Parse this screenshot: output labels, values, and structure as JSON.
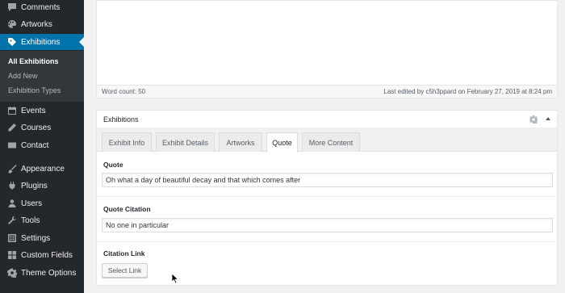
{
  "sidebar": {
    "items": [
      {
        "label": "Comments",
        "icon": "comment-icon"
      },
      {
        "label": "Artworks",
        "icon": "palette-icon"
      },
      {
        "label": "Exhibitions",
        "icon": "tag-icon"
      },
      {
        "label": "Events",
        "icon": "calendar-icon"
      },
      {
        "label": "Courses",
        "icon": "pencil-icon"
      },
      {
        "label": "Contact",
        "icon": "mail-icon"
      },
      {
        "label": "Appearance",
        "icon": "brush-icon"
      },
      {
        "label": "Plugins",
        "icon": "plugin-icon"
      },
      {
        "label": "Users",
        "icon": "users-icon"
      },
      {
        "label": "Tools",
        "icon": "wrench-icon"
      },
      {
        "label": "Settings",
        "icon": "settings-icon"
      },
      {
        "label": "Custom Fields",
        "icon": "grid-icon"
      },
      {
        "label": "Theme Options",
        "icon": "gear-icon"
      }
    ],
    "submenu": [
      {
        "label": "All Exhibitions"
      },
      {
        "label": "Add New"
      },
      {
        "label": "Exhibition Types"
      }
    ],
    "accent": "#0073aa",
    "background": "#23282d"
  },
  "editor": {
    "word_count": "Word count: 50",
    "last_edited": "Last edited by c5h3ppard on February 27, 2019 at 8:24 pm"
  },
  "exhibitions": {
    "title": "Exhibitions",
    "tabs": [
      {
        "label": "Exhibit Info"
      },
      {
        "label": "Exhibit Details"
      },
      {
        "label": "Artworks"
      },
      {
        "label": "Quote"
      },
      {
        "label": "More Content"
      }
    ],
    "active_tab": "Quote",
    "fields": {
      "quote_label": "Quote",
      "quote_value": "Oh what a day of beautiful decay and that which comes after",
      "citation_label": "Quote Citation",
      "citation_value": "No one in particular",
      "link_label": "Citation Link",
      "select_link": "Select Link"
    }
  }
}
